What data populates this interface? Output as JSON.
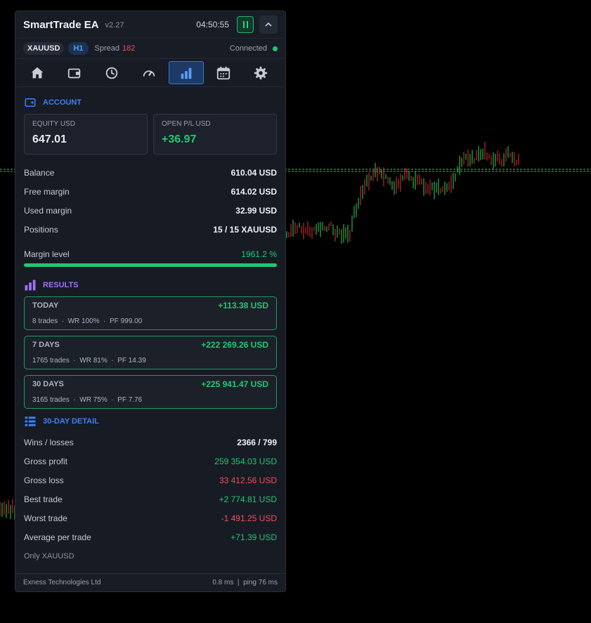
{
  "app": {
    "title": "SmartTrade EA",
    "version": "v2.27",
    "clock": "04:50:55"
  },
  "symbar": {
    "symbol": "XAUUSD",
    "timeframe": "H1",
    "spread_label": "Spread",
    "spread_value": "182",
    "status": "Connected"
  },
  "tabs": [
    {
      "icon": "home-icon",
      "active": false
    },
    {
      "icon": "wallet-icon",
      "active": false
    },
    {
      "icon": "clock-icon",
      "active": false
    },
    {
      "icon": "gauge-icon",
      "active": false
    },
    {
      "icon": "bar-chart-icon",
      "active": true
    },
    {
      "icon": "calendar-icon",
      "active": false
    },
    {
      "icon": "gear-icon",
      "active": false
    }
  ],
  "account": {
    "heading": "ACCOUNT",
    "equity_label": "EQUITY USD",
    "equity_value": "647.01",
    "openpl_label": "OPEN P/L USD",
    "openpl_value": "+36.97",
    "rows": [
      {
        "label": "Balance",
        "value": "610.04 USD"
      },
      {
        "label": "Free margin",
        "value": "614.02 USD"
      },
      {
        "label": "Used margin",
        "value": "32.99 USD"
      },
      {
        "label": "Positions",
        "value": "15 / 15 XAUUSD"
      }
    ],
    "margin_label": "Margin level",
    "margin_value": "1961.2 %",
    "margin_fill": 1.0
  },
  "results": {
    "heading": "RESULTS",
    "periods": [
      {
        "name": "TODAY",
        "pl": "+113.38 USD",
        "trades": "8 trades",
        "wr": "WR 100%",
        "pf": "PF 999.00"
      },
      {
        "name": "7 DAYS",
        "pl": "+222 269.26 USD",
        "trades": "1765 trades",
        "wr": "WR 81%",
        "pf": "PF 14.39"
      },
      {
        "name": "30 DAYS",
        "pl": "+225 941.47 USD",
        "trades": "3165 trades",
        "wr": "WR 75%",
        "pf": "PF 7.76"
      }
    ]
  },
  "detail": {
    "heading": "30-DAY DETAIL",
    "rows": [
      {
        "label": "Wins / losses",
        "value": "2366 / 799",
        "tone": "neutral"
      },
      {
        "label": "Gross profit",
        "value": "259 354.03 USD",
        "tone": "green"
      },
      {
        "label": "Gross loss",
        "value": "33 412.56 USD",
        "tone": "red"
      },
      {
        "label": "Best trade",
        "value": "+2 774.81 USD",
        "tone": "green"
      },
      {
        "label": "Worst trade",
        "value": "-1 491.25 USD",
        "tone": "red"
      },
      {
        "label": "Average per trade",
        "value": "+71.39 USD",
        "tone": "green"
      }
    ],
    "note": "Only XAUUSD"
  },
  "footer": {
    "broker": "Exness Technologies Ltd",
    "latency": "0.8 ms",
    "separator": "|",
    "ping": "ping 76 ms"
  },
  "colors": {
    "accent": "#3576d8",
    "green": "#22c874",
    "red": "#f04e5c",
    "purple": "#a070f0",
    "panel": "#171b24"
  }
}
